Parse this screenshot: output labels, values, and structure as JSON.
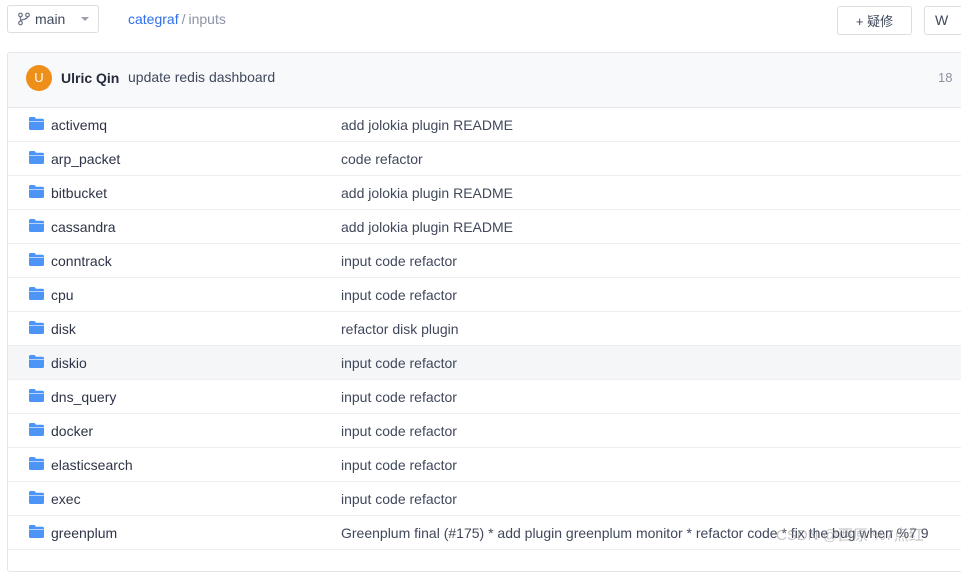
{
  "header": {
    "branch": "main",
    "breadcrumb_root": "categraf",
    "breadcrumb_sep": "/",
    "breadcrumb_current": "inputs",
    "issue_button": "+ 疑修",
    "w_button": "W"
  },
  "commit": {
    "avatar_letter": "U",
    "author": "Ulric Qin",
    "message": "update redis dashboard",
    "time": "18"
  },
  "files": [
    {
      "name": "activemq",
      "message": "add jolokia plugin README"
    },
    {
      "name": "arp_packet",
      "message": "code refactor"
    },
    {
      "name": "bitbucket",
      "message": "add jolokia plugin README"
    },
    {
      "name": "cassandra",
      "message": "add jolokia plugin README"
    },
    {
      "name": "conntrack",
      "message": "input code refactor"
    },
    {
      "name": "cpu",
      "message": "input code refactor"
    },
    {
      "name": "disk",
      "message": "refactor disk plugin"
    },
    {
      "name": "diskio",
      "message": "input code refactor"
    },
    {
      "name": "dns_query",
      "message": "input code refactor"
    },
    {
      "name": "docker",
      "message": "input code refactor"
    },
    {
      "name": "elasticsearch",
      "message": "input code refactor"
    },
    {
      "name": "exec",
      "message": "input code refactor"
    },
    {
      "name": "greenplum",
      "message": "Greenplum final (#175) * add plugin greenplum monitor * refactor code * fix the bug when %7 9"
    }
  ],
  "watermark": "CSDN @西原 %7点红",
  "colors": {
    "link": "#2f6ff0",
    "folder": "#4d94f7",
    "avatar": "#ee8f1a"
  }
}
